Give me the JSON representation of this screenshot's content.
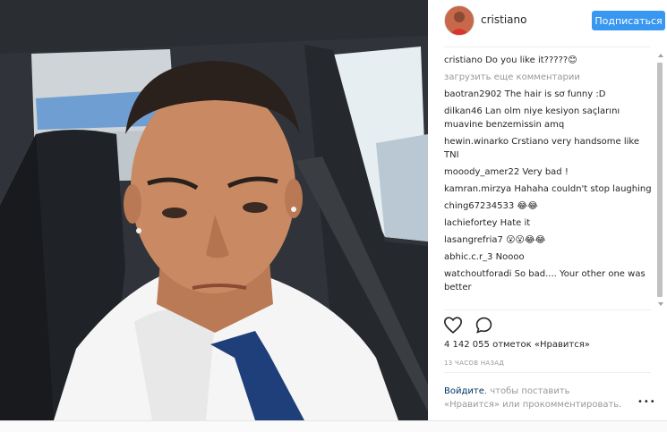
{
  "post": {
    "username": "cristiano",
    "follow_label": "Подписаться",
    "load_more": "загрузить еще комментарии",
    "comments": [
      {
        "user": "cristiano",
        "text": "Do you like it?????😊"
      },
      {
        "user": "baotran2902",
        "text": "The hair is sơ funny :D"
      },
      {
        "user": "dilkan46",
        "text": "Lan olm niye kesiyon saçlarını muavine benzemissin amq"
      },
      {
        "user": "hewin.winarko",
        "text": "Crstiano very handsome like TNI"
      },
      {
        "user": "mooody_amer22",
        "text": "Very bad !"
      },
      {
        "user": "kamran.mirzya",
        "text": "Hahaha couldn't stop laughing"
      },
      {
        "user": "ching67234533",
        "text": "😂😂"
      },
      {
        "user": "lachiefortey",
        "text": "Hate it"
      },
      {
        "user": "lasangrefria7",
        "text": "😮😮😂😂"
      },
      {
        "user": "abhic.c.r_3",
        "text": "Noooo"
      },
      {
        "user": "watchoutforadi",
        "text": "So bad.... Your other one was better"
      }
    ],
    "likes": "4 142 055 отметок «Нравится»",
    "time": "13 ЧАСОВ НАЗАД",
    "login_link": "Войдите",
    "login_rest": ", чтобы поставить «Нравится» или прокомментировать.",
    "more": "•••"
  },
  "icons": {
    "like": "heart-icon",
    "comment": "comment-icon",
    "more": "more-options-icon"
  },
  "colors": {
    "follow_button": "#3897f0",
    "link": "#003569",
    "muted": "#999999"
  }
}
